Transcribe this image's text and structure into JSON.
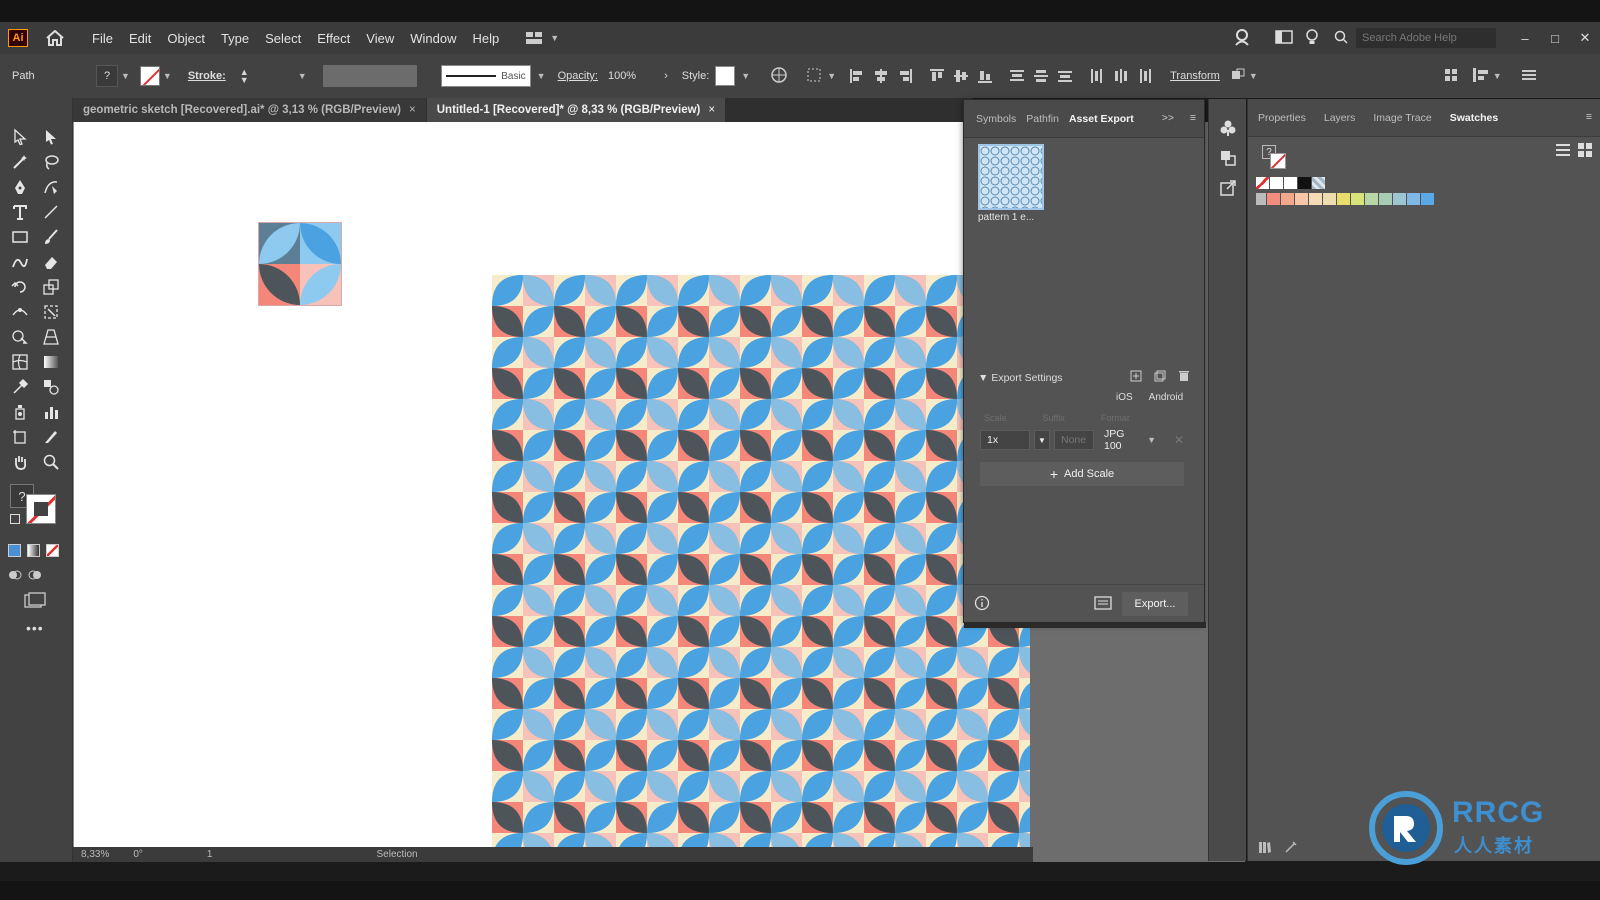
{
  "app": {
    "logo": "Ai"
  },
  "menu": [
    "File",
    "Edit",
    "Object",
    "Type",
    "Select",
    "Effect",
    "View",
    "Window",
    "Help"
  ],
  "search": {
    "placeholder": "Search Adobe Help"
  },
  "control_bar": {
    "selection_label": "Path",
    "stroke_label": "Stroke:",
    "brush_label": "Basic",
    "opacity_label": "Opacity:",
    "opacity_value": "100%",
    "style_label": "Style:",
    "transform_label": "Transform"
  },
  "tabs": [
    {
      "label": "geometric sketch [Recovered].ai* @ 3,13 % (RGB/Preview)",
      "close": "×"
    },
    {
      "label": "Untitled-1 [Recovered]* @ 8,33 % (RGB/Preview)",
      "close": "×"
    }
  ],
  "status": {
    "zoom": "8,33%",
    "rotation": "0°",
    "artboard": "1",
    "tool": "Selection"
  },
  "asset_panel": {
    "tabs": [
      "Symbols",
      "Pathfin",
      "Asset Export"
    ],
    "more": ">>",
    "asset_name": "pattern 1 e...",
    "export_settings_label": "Export Settings",
    "platforms": [
      "iOS",
      "Android"
    ],
    "headers": [
      "Scale",
      "Suffix",
      "Format"
    ],
    "scale_value": "1x",
    "suffix_placeholder": "None",
    "format_value": "JPG 100",
    "add_scale": "Add Scale",
    "export_button": "Export..."
  },
  "right_panel": {
    "tabs": [
      "Properties",
      "Layers",
      "Image Trace",
      "Swatches"
    ]
  },
  "watermark": {
    "text": "RRCG",
    "subtext": "人人素材"
  },
  "colors": {
    "pattern_blue": "#4aa3e0",
    "pattern_light_blue": "#8ec9ef",
    "pattern_slate": "#5c7f96",
    "pattern_dark": "#4e555a",
    "pattern_salmon": "#f4877a",
    "pattern_pink": "#f6c2ba",
    "pattern_cream": "#f6ecca"
  },
  "swatches": [
    "#f28d7e",
    "#f3a88e",
    "#f6c8a7",
    "#f5dcb6",
    "#eedcb0",
    "#e8dd6c",
    "#d7e27a",
    "#b9d6a7",
    "#a8cbb4",
    "#9dc5d2",
    "#7fb8e3",
    "#5aa8e6"
  ]
}
